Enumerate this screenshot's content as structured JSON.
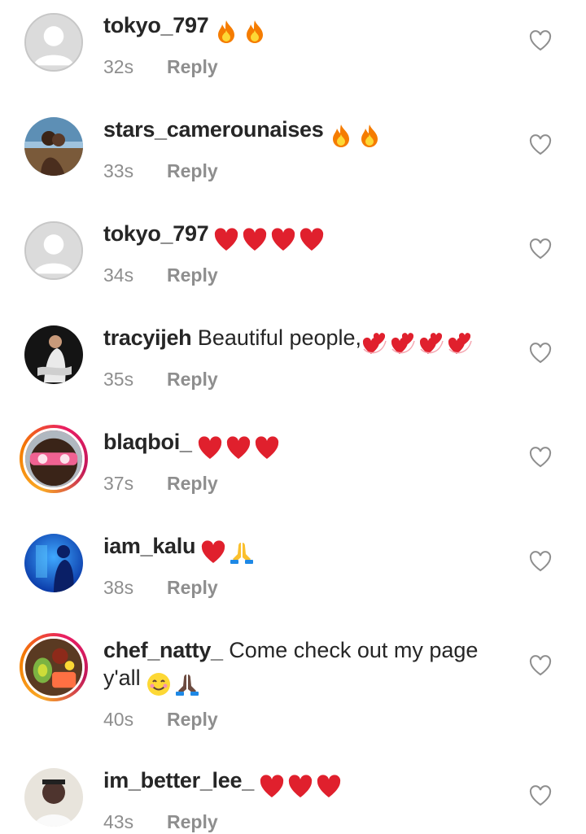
{
  "comments": [
    {
      "username": "tokyo_797",
      "message": "",
      "emojis": [
        "fire",
        "fire"
      ],
      "time": "32s",
      "reply": "Reply",
      "avatar": "default"
    },
    {
      "username": "stars_camerounaises",
      "message": "",
      "emojis": [
        "fire",
        "fire"
      ],
      "time": "33s",
      "reply": "Reply",
      "avatar": "photo-beach"
    },
    {
      "username": "tokyo_797",
      "message": "",
      "emojis": [
        "red-heart",
        "red-heart",
        "red-heart",
        "red-heart"
      ],
      "time": "34s",
      "reply": "Reply",
      "avatar": "default"
    },
    {
      "username": "tracyijeh",
      "message": "Beautiful people,",
      "emojis": [
        "revolving-hearts",
        "revolving-hearts",
        "revolving-hearts",
        "revolving-hearts"
      ],
      "time": "35s",
      "reply": "Reply",
      "avatar": "photo-dark"
    },
    {
      "username": "blaqboi_",
      "message": "",
      "emojis": [
        "red-heart",
        "red-heart",
        "red-heart"
      ],
      "time": "37s",
      "reply": "Reply",
      "avatar": "photo-sunglasses"
    },
    {
      "username": "iam_kalu",
      "message": "",
      "emojis": [
        "red-heart",
        "folded-hands"
      ],
      "time": "38s",
      "reply": "Reply",
      "avatar": "photo-blue"
    },
    {
      "username": "chef_natty_",
      "message": "Come check out my page y'all",
      "emojis": [
        "smiling-face",
        "folded-hands-dark"
      ],
      "time": "40s",
      "reply": "Reply",
      "avatar": "photo-food"
    },
    {
      "username": "im_better_lee_",
      "message": "",
      "emojis": [
        "red-heart",
        "red-heart",
        "red-heart"
      ],
      "time": "43s",
      "reply": "Reply",
      "avatar": "photo-portrait"
    }
  ],
  "colors": {
    "text": "#262626",
    "meta": "#8e8e8e",
    "heart_outline": "#8e8e8e",
    "story_ring_start": "#f9a825",
    "story_ring_end": "#e91e63"
  }
}
